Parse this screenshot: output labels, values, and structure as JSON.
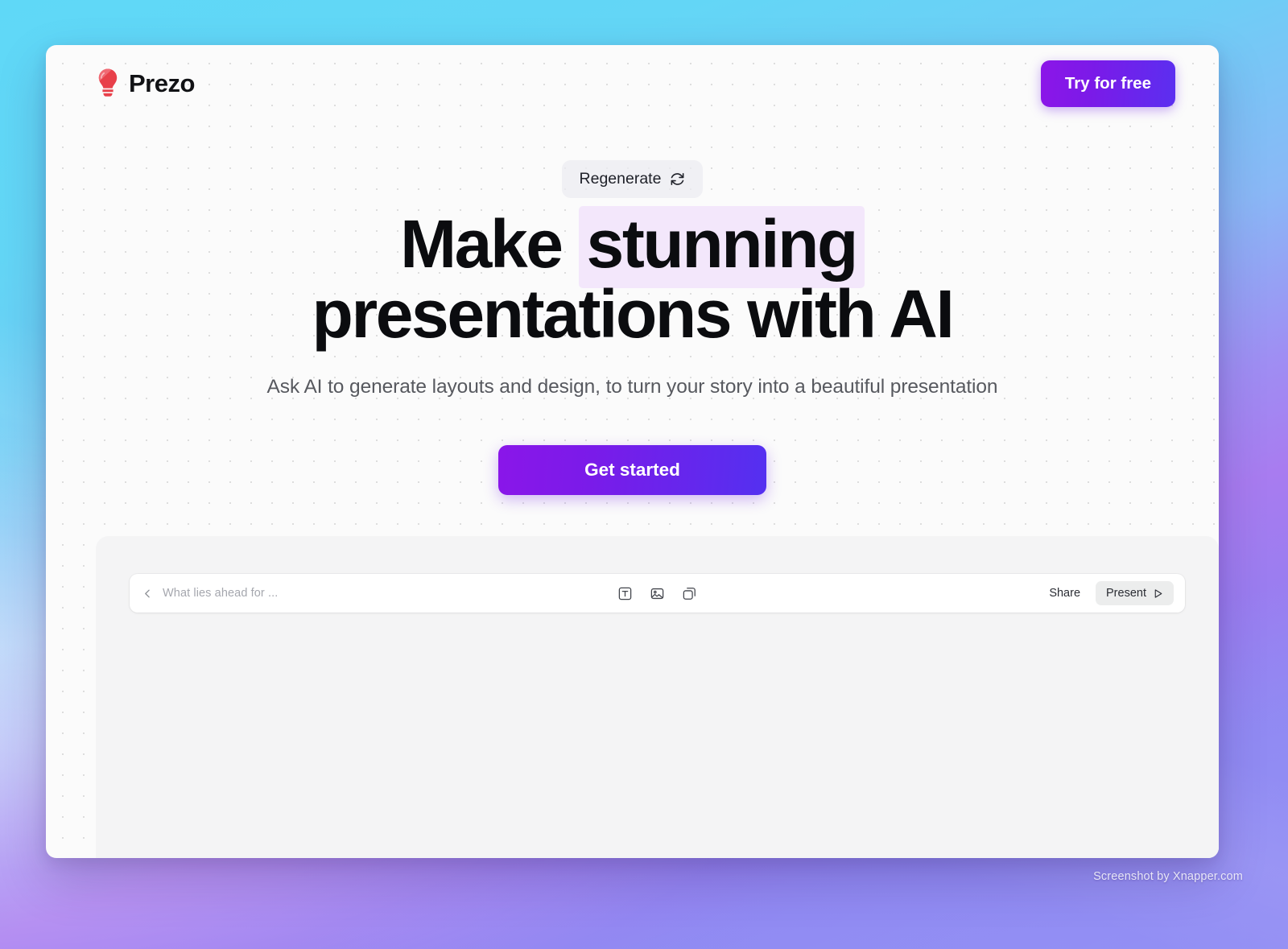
{
  "header": {
    "brand_name": "Prezo",
    "brand_icon": "lightbulb-icon",
    "brand_color": "#e8404a",
    "cta_label": "Try for free",
    "cta_gradient": [
      "#8c16e8",
      "#5b2ff0"
    ]
  },
  "hero": {
    "regenerate_label": "Regenerate",
    "regenerate_icon": "refresh-icon",
    "headline_part1": "Make ",
    "headline_highlight": "stunning",
    "headline_part2": "presentations with AI",
    "highlight_color": "#f3e7fb",
    "subheadline": "Ask AI to generate layouts and design, to turn your story into a beautiful presentation",
    "primary_cta_label": "Get started",
    "primary_cta_gradient": [
      "#8a16e9",
      "#5430f0"
    ]
  },
  "editor": {
    "back_icon": "chevron-left-icon",
    "doc_title": "What lies ahead for ...",
    "tools": [
      {
        "name": "text-tool-icon",
        "label": "Text"
      },
      {
        "name": "image-tool-icon",
        "label": "Image"
      },
      {
        "name": "shape-tool-icon",
        "label": "Shape"
      }
    ],
    "share_label": "Share",
    "present_label": "Present",
    "present_icon": "play-icon"
  },
  "watermark": {
    "text": "Screenshot by Xnapper.com"
  }
}
